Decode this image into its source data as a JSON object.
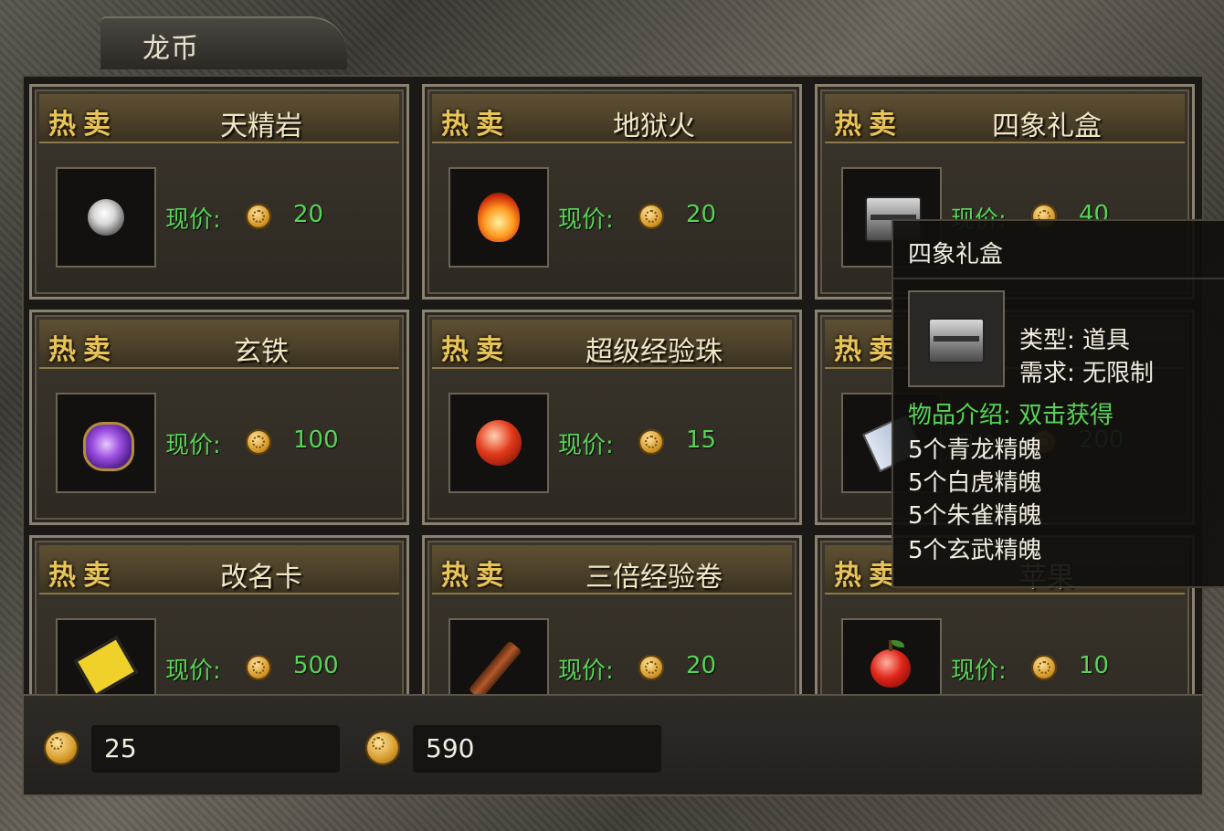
{
  "window": {
    "title": "龙币"
  },
  "hot_label": "热卖",
  "price_label": "现价:",
  "items": [
    {
      "name": "天精岩",
      "price": "20",
      "icon": "pearl-icon"
    },
    {
      "name": "地狱火",
      "price": "20",
      "icon": "fire-icon"
    },
    {
      "name": "四象礼盒",
      "price": "40",
      "icon": "chest-icon"
    },
    {
      "name": "玄铁",
      "price": "100",
      "icon": "purple-ore-icon"
    },
    {
      "name": "超级经验珠",
      "price": "15",
      "icon": "red-orb-icon"
    },
    {
      "name": "",
      "price": "200",
      "icon": "scroll-icon"
    },
    {
      "name": "改名卡",
      "price": "500",
      "icon": "rename-card-icon"
    },
    {
      "name": "三倍经验卷",
      "price": "20",
      "icon": "rod-icon"
    },
    {
      "name": "苹果",
      "price": "10",
      "icon": "apple-icon"
    }
  ],
  "balances": [
    {
      "value": "25"
    },
    {
      "value": "590"
    }
  ],
  "tooltip": {
    "title": "四象礼盒",
    "type": "类型: 道具",
    "requirement": "需求: 无限制",
    "intro": "物品介绍: 双击获得",
    "lines": [
      "5个青龙精魄",
      "5个白虎精魄",
      "5个朱雀精魄",
      "5个玄武精魄"
    ]
  }
}
